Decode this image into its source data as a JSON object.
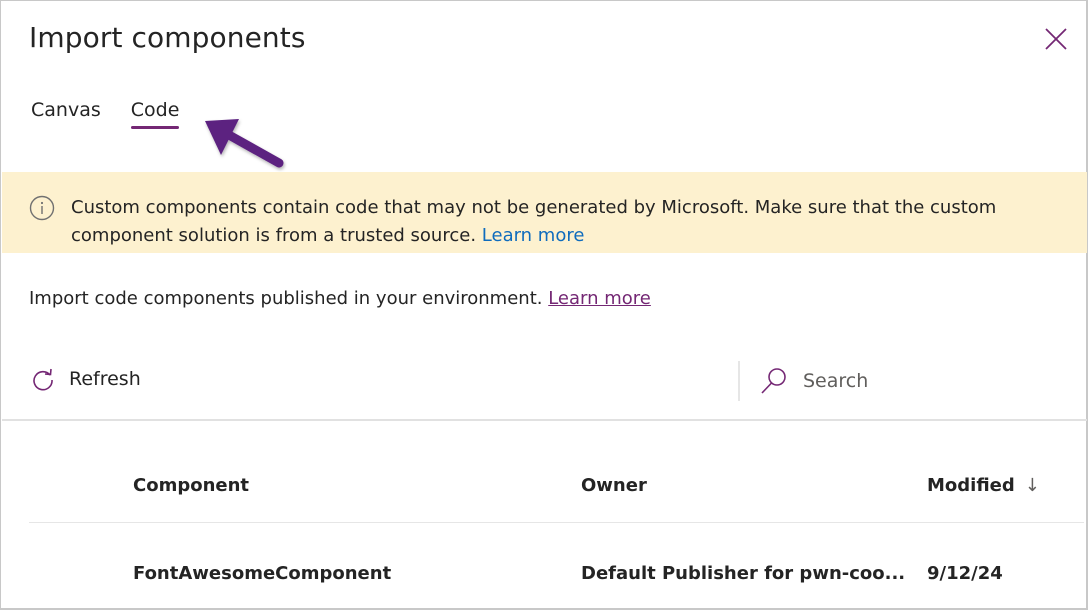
{
  "dialog": {
    "title": "Import components",
    "close_icon": "close-icon"
  },
  "tabs": [
    {
      "label": "Canvas",
      "active": false
    },
    {
      "label": "Code",
      "active": true
    }
  ],
  "annotation": {
    "arrow_icon": "arrow-pointer-icon",
    "color": "#5c2080"
  },
  "banner": {
    "icon": "info-icon",
    "text": "Custom components contain code that may not be generated by Microsoft. Make sure that the custom component solution is from a trusted source.",
    "link": "Learn more",
    "background": "#fdf1cf"
  },
  "subtitle": {
    "text": "Import code components published in your environment.",
    "link": "Learn more"
  },
  "toolbar": {
    "refresh_label": "Refresh",
    "refresh_icon": "refresh-icon",
    "search_icon": "search-icon",
    "search_placeholder": "Search",
    "search_value": ""
  },
  "table": {
    "columns": [
      {
        "label": "Component"
      },
      {
        "label": "Owner"
      },
      {
        "label": "Modified",
        "sort": "descending",
        "sort_glyph": "↓"
      }
    ],
    "rows": [
      {
        "component": "FontAwesomeComponent",
        "owner": "Default Publisher for pwn-coo...",
        "modified": "9/12/24"
      }
    ]
  },
  "colors": {
    "accent": "#742774",
    "link_blue": "#0f6cbd",
    "text": "#242424"
  }
}
